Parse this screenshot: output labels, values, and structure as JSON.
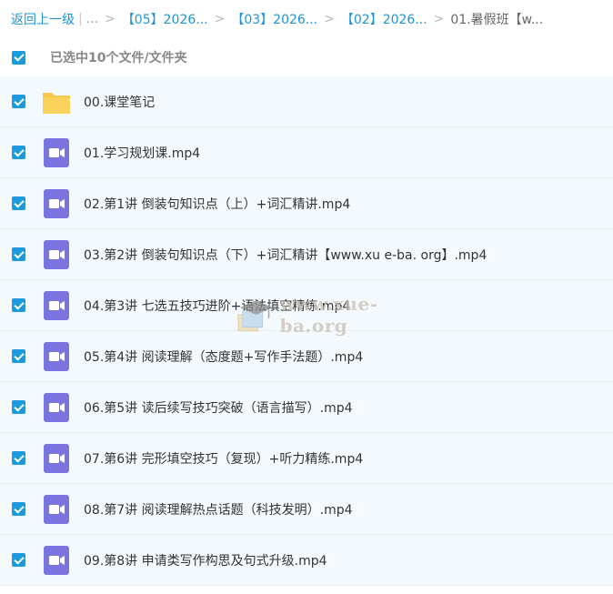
{
  "breadcrumb": {
    "back": "返回上一级",
    "ellipsis": "...",
    "items": [
      "【05】2026...",
      "【03】2026...",
      "【02】2026..."
    ],
    "current": "01.暑假班【w..."
  },
  "selection": {
    "label": "已选中10个文件/文件夹"
  },
  "files": [
    {
      "name": "00.课堂笔记",
      "type": "folder-icon"
    },
    {
      "name": "01.学习规划课.mp4",
      "type": "video-icon"
    },
    {
      "name": "02.第1讲 倒装句知识点（上）+词汇精讲.mp4",
      "type": "video-icon"
    },
    {
      "name": "03.第2讲 倒装句知识点（下）+词汇精讲【www.xu e-ba. org】.mp4",
      "type": "video-icon"
    },
    {
      "name": "04.第3讲 七选五技巧进阶+语法填空精练.mp4",
      "type": "video-icon"
    },
    {
      "name": "05.第4讲 阅读理解（态度题+写作手法题）.mp4",
      "type": "video-icon"
    },
    {
      "name": "06.第5讲 读后续写技巧突破（语言描写）.mp4",
      "type": "video-icon"
    },
    {
      "name": "07.第6讲 完形填空技巧（复现）+听力精练.mp4",
      "type": "video-icon"
    },
    {
      "name": "08.第7讲 阅读理解热点话题（科技发明）.mp4",
      "type": "video-icon"
    },
    {
      "name": "09.第8讲 申请类写作构思及句式升级.mp4",
      "type": "video-icon"
    }
  ],
  "watermark": "www.xue-ba.org",
  "colors": {
    "accent": "#1a9be0",
    "link": "#1f95d8",
    "video": "#7b73e0",
    "folder": "#f7c84a",
    "row_bg": "#f3f9fd"
  }
}
